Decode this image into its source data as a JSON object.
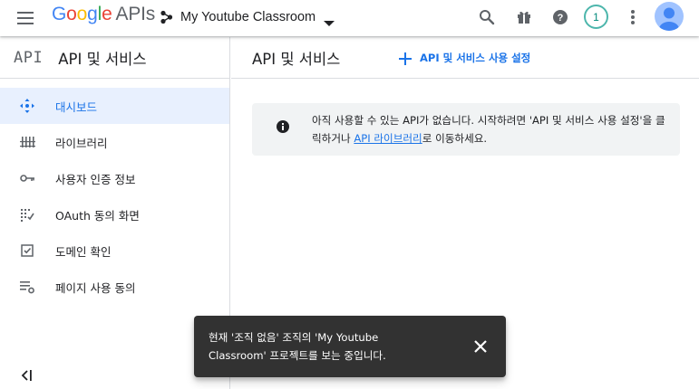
{
  "topbar": {
    "logo_google": [
      "G",
      "o",
      "o",
      "g",
      "l",
      "e"
    ],
    "logo_apis": "APIs",
    "project_name": "My Youtube Classroom",
    "notification_count": "1"
  },
  "sidebar": {
    "logo_text": "API",
    "title": "API 및 서비스",
    "items": [
      {
        "label": "대시보드",
        "icon": "dashboard-icon",
        "active": true
      },
      {
        "label": "라이브러리",
        "icon": "library-icon",
        "active": false
      },
      {
        "label": "사용자 인증 정보",
        "icon": "key-icon",
        "active": false
      },
      {
        "label": "OAuth 동의 화면",
        "icon": "consent-icon",
        "active": false
      },
      {
        "label": "도메인 확인",
        "icon": "domain-check-icon",
        "active": false
      },
      {
        "label": "페이지 사용 동의",
        "icon": "page-usage-icon",
        "active": false
      }
    ]
  },
  "main": {
    "title": "API 및 서비스",
    "enable_button": "API 및 서비스 사용 설정",
    "info": {
      "text_before": "아직 사용할 수 있는 API가 없습니다. 시작하려면 'API 및 서비스 사용 설정'을 클릭하거나 ",
      "link": "API 라이브러리",
      "text_after": "로 이동하세요."
    }
  },
  "snackbar": {
    "message": "현재 '조직 없음' 조직의 'My Youtube Classroom' 프로젝트를 보는 중입니다."
  },
  "colors": {
    "accent": "#1a73e8",
    "active_bg": "#e8f0fe",
    "badge": "#4db6ac",
    "snackbar_bg": "#323232"
  }
}
